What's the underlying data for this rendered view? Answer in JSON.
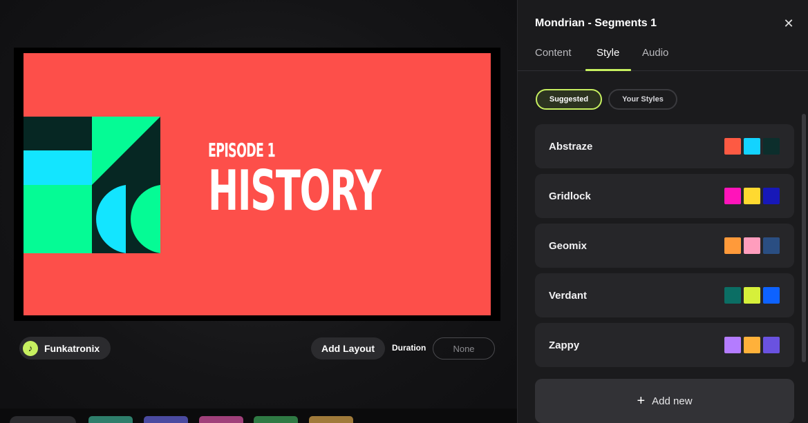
{
  "slide": {
    "episode_label": "EPISODE 1",
    "title": "HISTORY",
    "background_color": "#fd4f4a"
  },
  "music": {
    "track_name": "Funkatronix",
    "icon": "music-note-icon"
  },
  "controls": {
    "add_layout_label": "Add Layout",
    "duration_label": "Duration",
    "duration_value": "None"
  },
  "panel": {
    "title": "Mondrian - Segments 1",
    "close_icon": "close-icon",
    "tabs": [
      {
        "label": "Content",
        "active": false
      },
      {
        "label": "Style",
        "active": true
      },
      {
        "label": "Audio",
        "active": false
      }
    ],
    "filters": {
      "suggested": "Suggested",
      "your_styles": "Your Styles"
    },
    "styles": [
      {
        "name": "Abstraze",
        "colors": [
          "#fd5a43",
          "#13d3ff",
          "#0c2e2c"
        ]
      },
      {
        "name": "Gridlock",
        "colors": [
          "#ff14ba",
          "#ffd930",
          "#1718b8"
        ]
      },
      {
        "name": "Geomix",
        "colors": [
          "#ff9a3a",
          "#ff9dbd",
          "#2a4e82"
        ]
      },
      {
        "name": "Verdant",
        "colors": [
          "#0b6e64",
          "#d6f03a",
          "#0d62ff"
        ]
      },
      {
        "name": "Zappy",
        "colors": [
          "#b47cff",
          "#ffb13a",
          "#6a52e0"
        ]
      }
    ],
    "add_new_label": "Add new"
  },
  "accent_color": "#c7f060"
}
